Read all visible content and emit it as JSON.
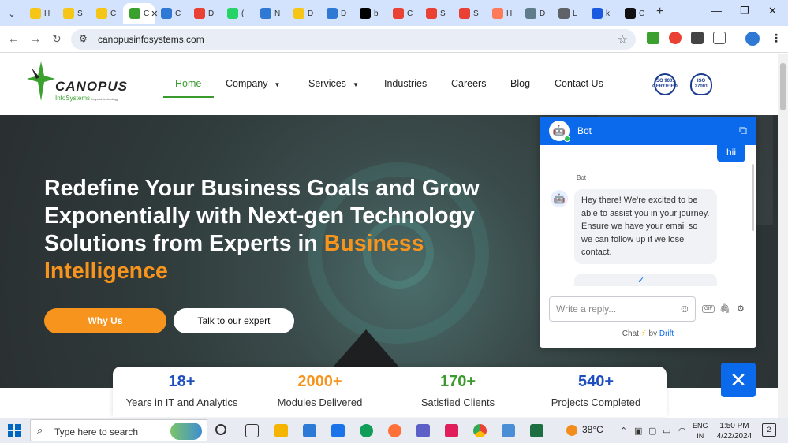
{
  "browser": {
    "tabs": [
      {
        "letter": "H",
        "icon": "warning-icon",
        "color": "#f5c518"
      },
      {
        "letter": "S",
        "icon": "warning-icon",
        "color": "#f5c518"
      },
      {
        "letter": "C",
        "icon": "warning-icon",
        "color": "#f5c518"
      },
      {
        "letter": "C",
        "icon": "canopus-icon",
        "color": "#3aa12e",
        "active": true
      },
      {
        "letter": "C",
        "icon": "drive-icon",
        "color": "#2f78d4"
      },
      {
        "letter": "D",
        "icon": "doc-icon",
        "color": "#e94235"
      },
      {
        "letter": "(",
        "icon": "whatsapp-icon",
        "color": "#25d366"
      },
      {
        "letter": "N",
        "icon": "drive-icon",
        "color": "#2f78d4"
      },
      {
        "letter": "D",
        "icon": "drive-icon",
        "color": "#f5c518"
      },
      {
        "letter": "D",
        "icon": "drive-icon",
        "color": "#2f78d4"
      },
      {
        "letter": "b",
        "icon": "medium-icon",
        "color": "#000000"
      },
      {
        "letter": "C",
        "icon": "target-icon",
        "color": "#e94235"
      },
      {
        "letter": "S",
        "icon": "target-icon",
        "color": "#e94235"
      },
      {
        "letter": "S",
        "icon": "target-icon",
        "color": "#e94235"
      },
      {
        "letter": "H",
        "icon": "hubspot-icon",
        "color": "#ff7a59"
      },
      {
        "letter": "D",
        "icon": "app-icon",
        "color": "#5f7c8a"
      },
      {
        "letter": "L",
        "icon": "globe-icon",
        "color": "#5f6368"
      },
      {
        "letter": "k",
        "icon": "p-icon",
        "color": "#1a5ae0"
      },
      {
        "letter": "C",
        "icon": "circle-icon",
        "color": "#111111"
      }
    ],
    "new_tab": "+",
    "window_controls": [
      "—",
      "❐",
      "✕"
    ],
    "url": "canopusinfosystems.com"
  },
  "site": {
    "logo_name": "CANOPUS",
    "logo_sub": "InfoSystems",
    "logo_sub_tagline": "beyond technology",
    "nav": [
      {
        "label": "Home",
        "active": true,
        "dropdown": false
      },
      {
        "label": "Company",
        "dropdown": true
      },
      {
        "label": "Services",
        "dropdown": true
      },
      {
        "label": "Industries",
        "dropdown": false
      },
      {
        "label": "Careers",
        "dropdown": false
      },
      {
        "label": "Blog",
        "dropdown": false
      },
      {
        "label": "Contact Us",
        "dropdown": false
      }
    ],
    "badges": [
      "ISO 9001 CERTIFIED",
      "ISO 27001"
    ],
    "colors": {
      "brand_green": "#3a9a2e",
      "accent_orange": "#f7941d",
      "drift_blue": "#0b6aeb"
    }
  },
  "hero": {
    "title_main": "Redefine Your Business Goals and Grow Exponentially with Next-gen Technology Solutions from Experts in ",
    "title_highlight": "Business Intelligence",
    "btn_primary": "Why Us",
    "btn_secondary": "Talk to our expert"
  },
  "stats": [
    {
      "num": "18+",
      "label": "Years in IT and Analytics",
      "color": "#1f4fbf"
    },
    {
      "num": "2000+",
      "label": "Modules Delivered",
      "color": "#f7941d"
    },
    {
      "num": "170+",
      "label": "Satisfied Clients",
      "color": "#3a9a2e"
    },
    {
      "num": "540+",
      "label": "Projects Completed",
      "color": "#1f4fbf"
    }
  ],
  "chat": {
    "title": "Bot",
    "user_message": "hii",
    "bot_label": "Bot",
    "bot_message": "Hey there! We're excited to be able to assist you in your journey. Ensure we have your email so we can follow up if we lose contact.",
    "reply_placeholder": "Write a reply...",
    "gif_label": "GIF",
    "powered_prefix": "Chat",
    "powered_by": "by",
    "powered_brand": "Drift",
    "close_glyph": "✕"
  },
  "taskbar": {
    "search_placeholder": "Type here to search",
    "weather": "38°C",
    "lang_line1": "ENG",
    "lang_line2": "IN",
    "time": "1:50 PM",
    "date": "4/22/2024",
    "notifications": "2"
  }
}
